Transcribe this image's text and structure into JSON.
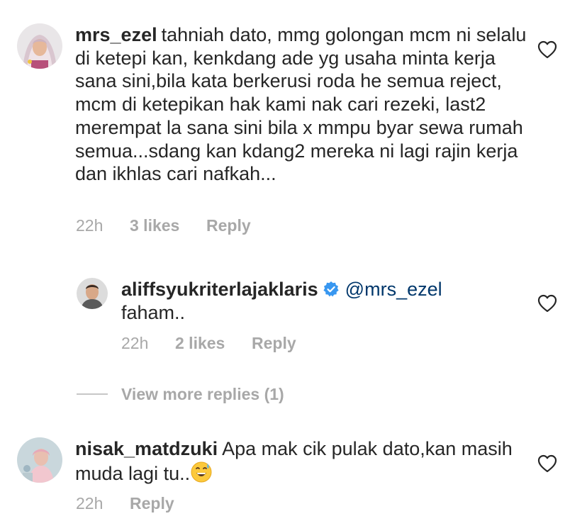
{
  "comments": [
    {
      "username": "mrs_ezel",
      "text": "tahniah dato, mmg golongan mcm ni selalu di ketepi kan, kenkdang ade yg usaha minta kerja sana sini,bila kata berkerusi roda he semua reject, mcm di ketepikan hak kami nak cari rezeki, last2 merempat la sana sini bila x mmpu byar sewa rumah semua...sdang kan kdang2 mereka ni lagi rajin kerja dan ikhlas cari nafkah...",
      "time": "22h",
      "likes": "3 likes",
      "reply": "Reply",
      "avatar_icon": "profile-photo-hijab-woman",
      "like_icon": "heart-outline-icon"
    },
    {
      "username": "aliffsyukriterlajaklaris",
      "verified": true,
      "mention": "@mrs_ezel",
      "text": "faham..",
      "time": "22h",
      "likes": "2 likes",
      "reply": "Reply",
      "avatar_icon": "profile-photo-man",
      "like_icon": "heart-outline-icon",
      "verified_icon": "verified-badge-icon"
    },
    {
      "username": "nisak_matdzuki",
      "text": "Apa mak cik pulak dato,kan masih muda lagi tu..",
      "emoji": "grinning-face-with-sweat-emoji",
      "time": "22h",
      "reply": "Reply",
      "avatar_icon": "profile-photo-woman",
      "like_icon": "heart-outline-icon"
    }
  ],
  "view_more_replies": "View more replies (1)",
  "colors": {
    "text": "#262626",
    "meta": "#a8a8a8",
    "mention": "#00376b",
    "verified": "#3897f0"
  }
}
